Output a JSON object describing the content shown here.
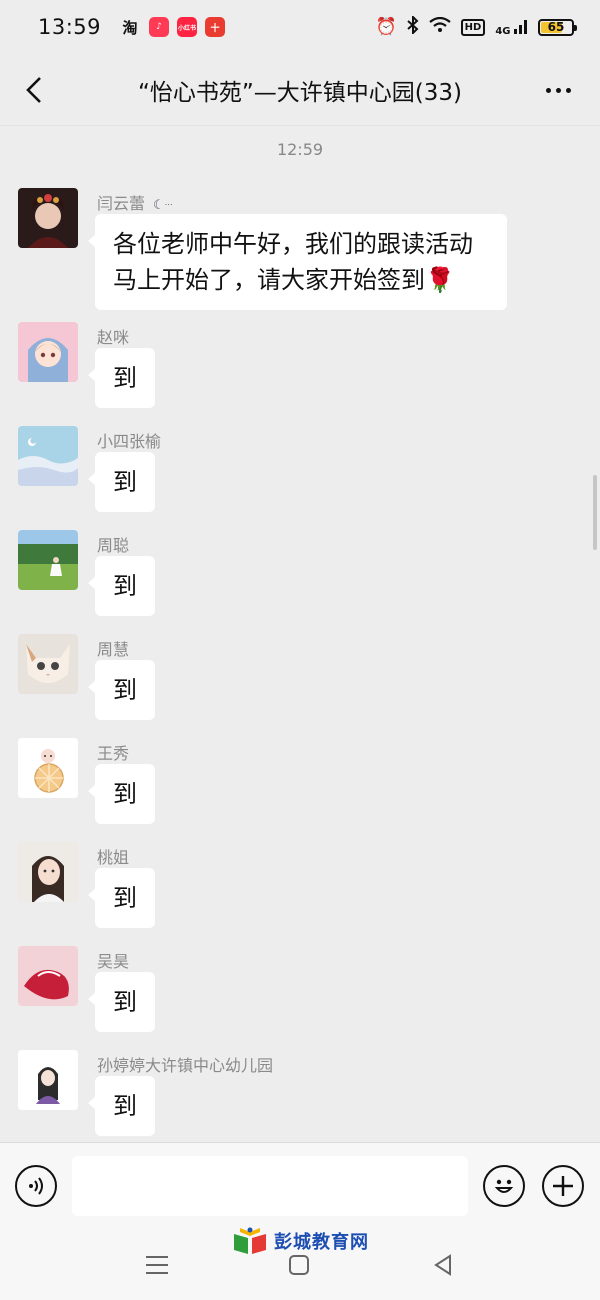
{
  "status_bar": {
    "time": "13:59",
    "battery": "65",
    "network": "4G",
    "hd": "HD",
    "apps": {
      "taobao": "淘",
      "red": "小红书",
      "ten": "十"
    }
  },
  "header": {
    "title": "“怡心书苑”—大许镇中心园(33)"
  },
  "timestamp": "12:59",
  "messages": [
    {
      "sender": "闫云蕾",
      "text": "各位老师中午好，我们的跟读活动马上开始了，请大家开始签到🌹"
    },
    {
      "sender": "赵咪",
      "text": "到"
    },
    {
      "sender": "小四张榆",
      "text": "到"
    },
    {
      "sender": "周聪",
      "text": "到"
    },
    {
      "sender": "周慧",
      "text": "到"
    },
    {
      "sender": "王秀",
      "text": "到"
    },
    {
      "sender": "桃姐",
      "text": "到"
    },
    {
      "sender": "吴昊",
      "text": "到"
    },
    {
      "sender": "孙婷婷大许镇中心幼儿园",
      "text": "到"
    }
  ],
  "watermark": "彭城教育网",
  "colors": {
    "background": "#ededed",
    "bubble": "#ffffff",
    "sender": "#8a8a8a",
    "watermark": "#1d4fb3"
  },
  "icons": {
    "back": "chevron-left-icon",
    "more": "more-dots-icon",
    "voice": "voice-icon",
    "emoji": "smiley-icon",
    "plus": "plus-icon"
  }
}
